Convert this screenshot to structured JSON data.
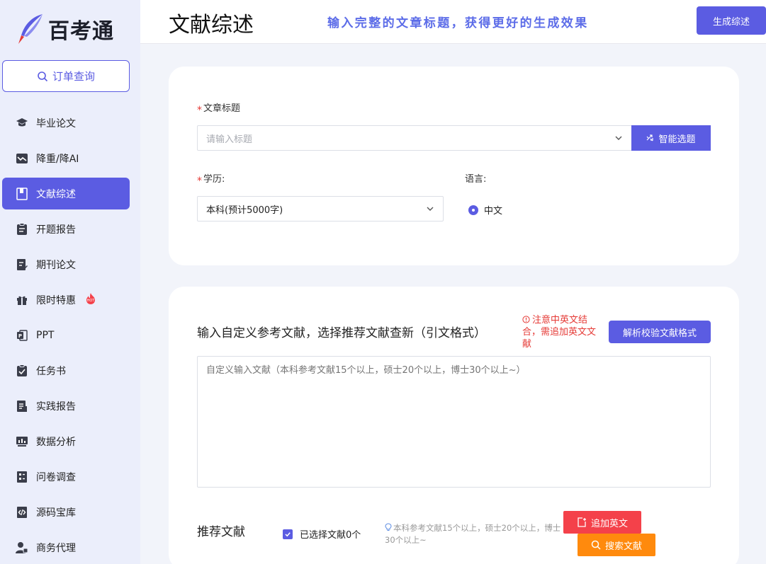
{
  "brand": {
    "name": "百考通"
  },
  "sidebar": {
    "order_button": "订单查询",
    "items": [
      {
        "label": "毕业论文",
        "icon": "graduation-cap-icon",
        "active": false
      },
      {
        "label": "降重/降AI",
        "icon": "trend-chart-icon",
        "active": false
      },
      {
        "label": "文献综述",
        "icon": "book-icon",
        "active": true
      },
      {
        "label": "开题报告",
        "icon": "clipboard-icon",
        "active": false
      },
      {
        "label": "期刊论文",
        "icon": "journal-edit-icon",
        "active": false
      },
      {
        "label": "限时特惠",
        "icon": "gift-icon",
        "active": false,
        "badge": "HOT"
      },
      {
        "label": "PPT",
        "icon": "ppt-icon",
        "active": false
      },
      {
        "label": "任务书",
        "icon": "task-clipboard-icon",
        "active": false
      },
      {
        "label": "实践报告",
        "icon": "report-icon",
        "active": false
      },
      {
        "label": "数据分析",
        "icon": "bar-chart-icon",
        "active": false
      },
      {
        "label": "问卷调查",
        "icon": "survey-icon",
        "active": false
      },
      {
        "label": "源码宝库",
        "icon": "code-file-icon",
        "active": false
      },
      {
        "label": "商务代理",
        "icon": "business-user-icon",
        "active": false
      }
    ]
  },
  "header": {
    "title": "文献综述",
    "slogan": "输入完整的文章标题，获得更好的生成效果",
    "generate_button": "生成综述"
  },
  "form": {
    "title_label": "文章标题",
    "title_placeholder": "请输入标题",
    "smart_button": "智能选题",
    "education_label": "学历:",
    "education_value": "本科(预计5000字)",
    "language_label": "语言:",
    "language_value": "中文"
  },
  "references": {
    "section_title": "输入自定义参考文献，选择推荐文献查新（引文格式）",
    "warning": "注意中英文结合，需追加英文文献",
    "parse_button": "解析校验文献格式",
    "textarea_placeholder": "自定义输入文献（本科参考文献15个以上，硕士20个以上，博士30个以上~）",
    "recommended_title": "推荐文献",
    "selected_text": "已选择文献0个",
    "hint": "本科参考文献15个以上，硕士20个以上，博士30个以上~",
    "add_english_button": "追加英文",
    "search_button": "搜索文献"
  },
  "colors": {
    "primary": "#5b5ce2",
    "sidebar_bg": "#ebeefb",
    "page_bg": "#f2f4fa",
    "danger": "#f4414a",
    "warning_orange": "#ff8a0d",
    "slogan": "#5c6ce8"
  }
}
